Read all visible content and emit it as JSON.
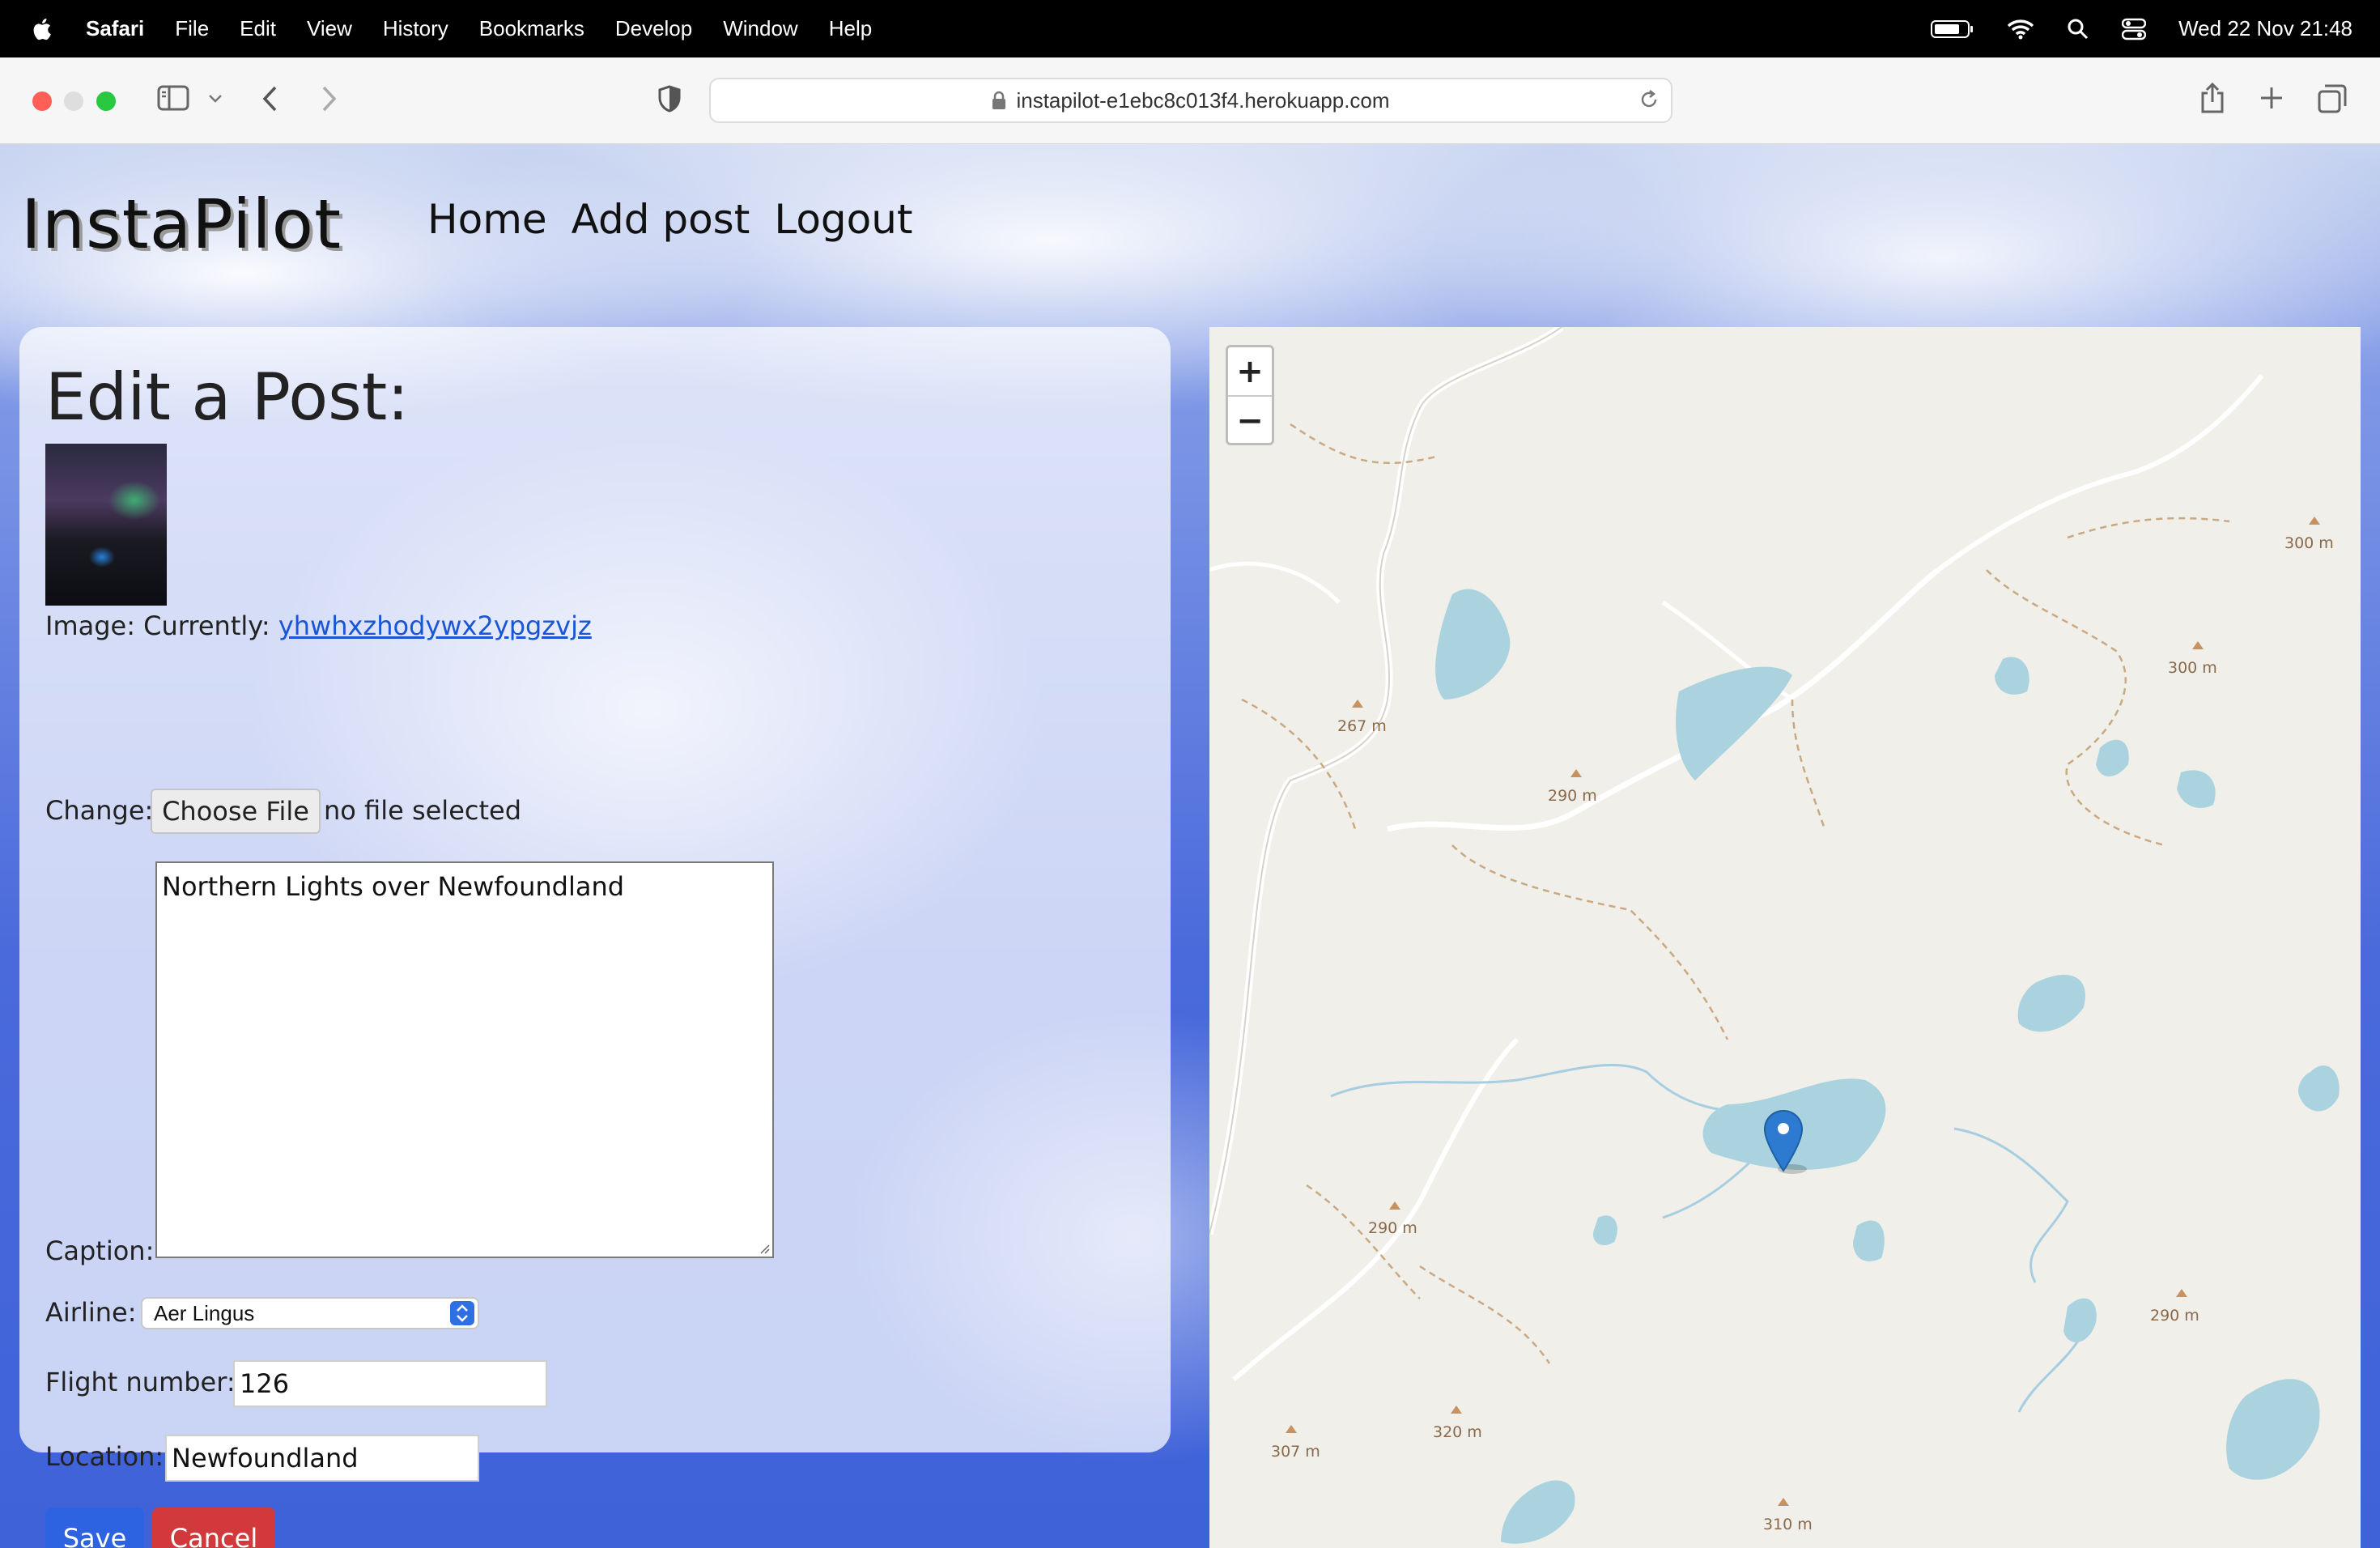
{
  "menubar": {
    "app_name": "Safari",
    "items": [
      "File",
      "Edit",
      "View",
      "History",
      "Bookmarks",
      "Develop",
      "Window",
      "Help"
    ],
    "clock": "Wed 22 Nov  21:48"
  },
  "browser": {
    "url": "instapilot-e1ebc8c013f4.herokuapp.com"
  },
  "site": {
    "brand": "InstaPilot",
    "nav": [
      "Home",
      "Add post",
      "Logout"
    ]
  },
  "form": {
    "heading": "Edit a Post:",
    "image_label": "Image: Currently:",
    "image_link": "yhwhxzhodywx2ypgzvjz",
    "change_label": "Change:",
    "choose_file": "Choose File",
    "no_file": "no file selected",
    "caption_label": "Caption:",
    "caption_value": "Northern Lights over Newfoundland",
    "airline_label": "Airline:",
    "airline_value": "Aer Lingus",
    "flight_label": "Flight number:",
    "flight_value": "126",
    "location_label": "Location:",
    "location_value": "Newfoundland",
    "save": "Save",
    "cancel": "Cancel"
  },
  "map": {
    "zoom_in": "+",
    "zoom_out": "−",
    "peaks": [
      "300 m",
      "300 m",
      "267 m",
      "290 m",
      "290 m",
      "290 m",
      "320 m",
      "307 m",
      "310 m"
    ],
    "marker": "location-marker"
  }
}
